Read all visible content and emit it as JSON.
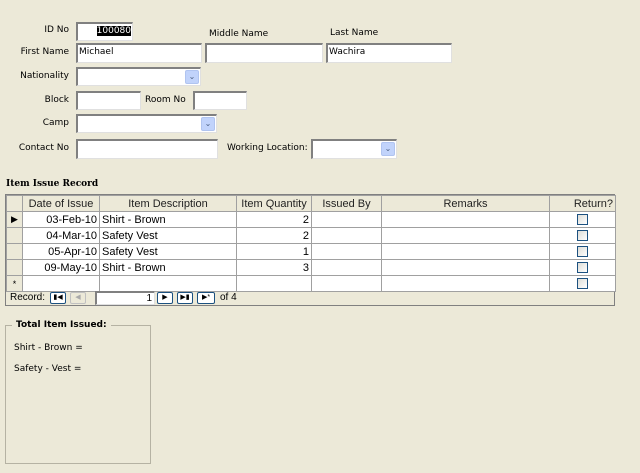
{
  "form": {
    "id_label": "ID No",
    "id_value": "100080",
    "first_name_label": "First Name",
    "first_name": "Michael",
    "middle_name_label": "Middle Name",
    "middle_name": "",
    "last_name_label": "Last Name",
    "last_name": "Wachira",
    "nationality_label": "Nationality",
    "nationality": "",
    "block_label": "Block",
    "block": "",
    "room_label": "Room No",
    "room": "",
    "camp_label": "Camp",
    "camp": "",
    "contact_label": "Contact No",
    "contact": "",
    "working_location_label": "Working Location:",
    "working_location": ""
  },
  "grid": {
    "title": "Item Issue Record",
    "columns": [
      "Date of Issue",
      "Item Description",
      "Item Quantity",
      "Issued By",
      "Remarks",
      "Return?"
    ],
    "rows": [
      {
        "date": "03-Feb-10",
        "desc": "Shirt - Brown",
        "qty": "2",
        "by": "",
        "remarks": ""
      },
      {
        "date": "04-Mar-10",
        "desc": "Safety Vest",
        "qty": "2",
        "by": "",
        "remarks": ""
      },
      {
        "date": "05-Apr-10",
        "desc": "Safety Vest",
        "qty": "1",
        "by": "",
        "remarks": ""
      },
      {
        "date": "09-May-10",
        "desc": "Shirt - Brown",
        "qty": "3",
        "by": "",
        "remarks": ""
      }
    ],
    "new_row_marker": "*",
    "nav": {
      "label": "Record:",
      "current": "1",
      "of": "of 4"
    }
  },
  "totals": {
    "title": "Total Item Issued:",
    "shirt": "Shirt - Brown =",
    "vest": "Safety - Vest ="
  }
}
